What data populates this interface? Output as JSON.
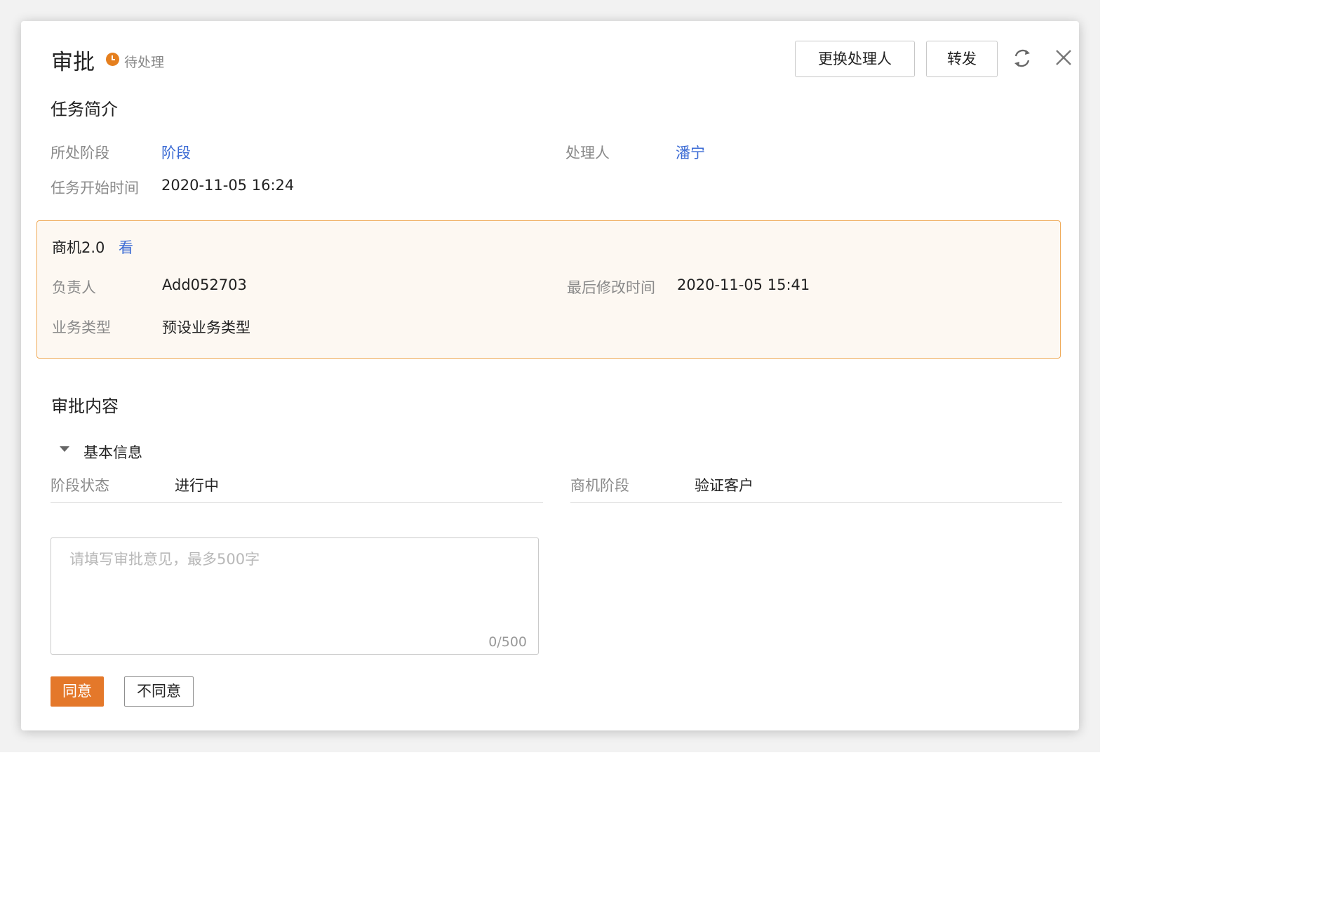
{
  "header": {
    "title": "审批",
    "status": "待处理",
    "buttons": {
      "change_handler": "更换处理人",
      "forward": "转发"
    },
    "icons": [
      "refresh-icon",
      "close-icon"
    ]
  },
  "task_intro": {
    "section_title": "任务简介",
    "fields": {
      "stage_label": "所处阶段",
      "stage_value": "阶段",
      "handler_label": "处理人",
      "handler_value": "潘宁",
      "start_time_label": "任务开始时间",
      "start_time_value": "2020-11-05 16:24"
    }
  },
  "record_card": {
    "title": "商机2.0",
    "view_link": "看",
    "fields": {
      "owner_label": "负责人",
      "owner_value": "Add052703",
      "modified_label": "最后修改时间",
      "modified_value": "2020-11-05 15:41",
      "biz_type_label": "业务类型",
      "biz_type_value": "预设业务类型"
    }
  },
  "approval": {
    "section_title": "审批内容",
    "group_title": "基本信息",
    "fields": {
      "stage_status_label": "阶段状态",
      "stage_status_value": "进行中",
      "opportunity_stage_label": "商机阶段",
      "opportunity_stage_value": "验证客户"
    },
    "comment": {
      "placeholder": "请填写审批意见，最多500字",
      "counter": "0/500"
    },
    "actions": {
      "agree": "同意",
      "disagree": "不同意"
    }
  },
  "colors": {
    "accent": "#e4782a",
    "link": "#3a6ad4",
    "card_border": "#efaa58",
    "card_background": "#fdf8f2"
  }
}
